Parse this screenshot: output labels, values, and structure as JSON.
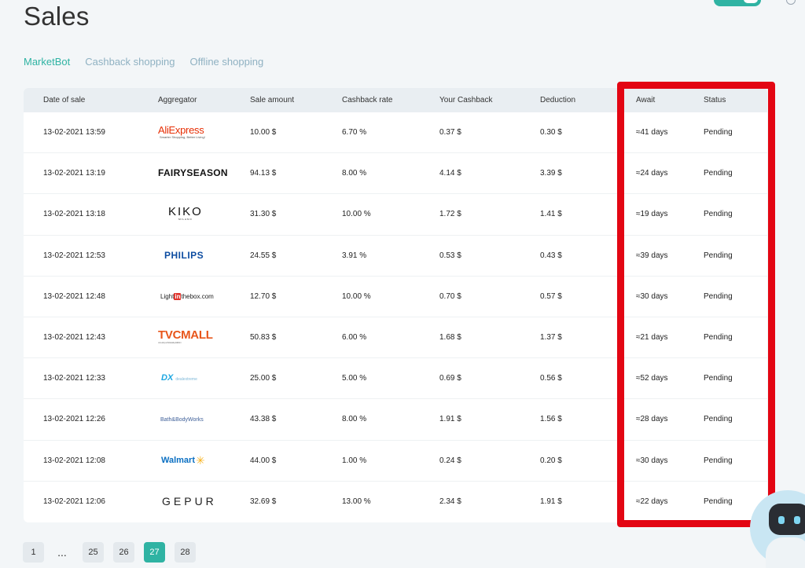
{
  "page": {
    "title": "Sales"
  },
  "tabs": [
    {
      "label": "MarketBot",
      "active": true
    },
    {
      "label": "Cashback shopping",
      "active": false
    },
    {
      "label": "Offline shopping",
      "active": false
    }
  ],
  "table": {
    "columns": [
      "Date of sale",
      "Aggregator",
      "Sale amount",
      "Cashback rate",
      "Your Cashback",
      "Deduction",
      "Await",
      "Status"
    ],
    "rows": [
      {
        "date": "13-02-2021 13:59",
        "aggregator": "AliExpress",
        "amount": "10.00 $",
        "rate": "6.70 %",
        "cashback": "0.37 $",
        "deduction": "0.30 $",
        "await": "≈41 days",
        "status": "Pending"
      },
      {
        "date": "13-02-2021 13:19",
        "aggregator": "FAIRYSEASON",
        "amount": "94.13 $",
        "rate": "8.00 %",
        "cashback": "4.14 $",
        "deduction": "3.39 $",
        "await": "≈24 days",
        "status": "Pending"
      },
      {
        "date": "13-02-2021 13:18",
        "aggregator": "KIKO",
        "amount": "31.30 $",
        "rate": "10.00 %",
        "cashback": "1.72 $",
        "deduction": "1.41 $",
        "await": "≈19 days",
        "status": "Pending"
      },
      {
        "date": "13-02-2021 12:53",
        "aggregator": "PHILIPS",
        "amount": "24.55 $",
        "rate": "3.91 %",
        "cashback": "0.53 $",
        "deduction": "0.43 $",
        "await": "≈39 days",
        "status": "Pending"
      },
      {
        "date": "13-02-2021 12:48",
        "aggregator": "LightInTheBox",
        "amount": "12.70 $",
        "rate": "10.00 %",
        "cashback": "0.70 $",
        "deduction": "0.57 $",
        "await": "≈30 days",
        "status": "Pending"
      },
      {
        "date": "13-02-2021 12:43",
        "aggregator": "TVCMALL",
        "amount": "50.83 $",
        "rate": "6.00 %",
        "cashback": "1.68 $",
        "deduction": "1.37 $",
        "await": "≈21 days",
        "status": "Pending"
      },
      {
        "date": "13-02-2021 12:33",
        "aggregator": "DX",
        "amount": "25.00 $",
        "rate": "5.00 %",
        "cashback": "0.69 $",
        "deduction": "0.56 $",
        "await": "≈52 days",
        "status": "Pending"
      },
      {
        "date": "13-02-2021 12:26",
        "aggregator": "Bath&BodyWorks",
        "amount": "43.38 $",
        "rate": "8.00 %",
        "cashback": "1.91 $",
        "deduction": "1.56 $",
        "await": "≈28 days",
        "status": "Pending"
      },
      {
        "date": "13-02-2021 12:08",
        "aggregator": "Walmart",
        "amount": "44.00 $",
        "rate": "1.00 %",
        "cashback": "0.24 $",
        "deduction": "0.20 $",
        "await": "≈30 days",
        "status": "Pending"
      },
      {
        "date": "13-02-2021 12:06",
        "aggregator": "GEPUR",
        "amount": "32.69 $",
        "rate": "13.00 %",
        "cashback": "2.34 $",
        "deduction": "1.91 $",
        "await": "≈22 days",
        "status": "Pending"
      }
    ]
  },
  "logos": {
    "ali": {
      "name": "AliExpress",
      "tagline": "Smarter Shopping, Better Living!"
    },
    "fairy": "FAIRYSEASON",
    "kiko": {
      "name": "KIKO",
      "sub": "MILANO"
    },
    "philips": "PHILIPS",
    "lib": {
      "pre": "Light",
      "mid": "in",
      "post": "thebox.com"
    },
    "tvc": {
      "name": "TVCMALL",
      "tagline": "one-stop-wholesale-platform"
    },
    "dx": {
      "mark": "DX",
      "name": "dealextreme"
    },
    "bbw": "Bath&BodyWorks",
    "walmart": {
      "name": "Walmart",
      "spark": "✳"
    },
    "gepur": "GEPUR"
  },
  "pagination": {
    "first": "1",
    "ellipsis": "...",
    "pages": [
      "25",
      "26",
      "27",
      "28"
    ],
    "active": "27"
  },
  "colors": {
    "accent": "#2fb3a3",
    "highlight": "#e30613",
    "tab_inactive": "#8fb1c2"
  }
}
